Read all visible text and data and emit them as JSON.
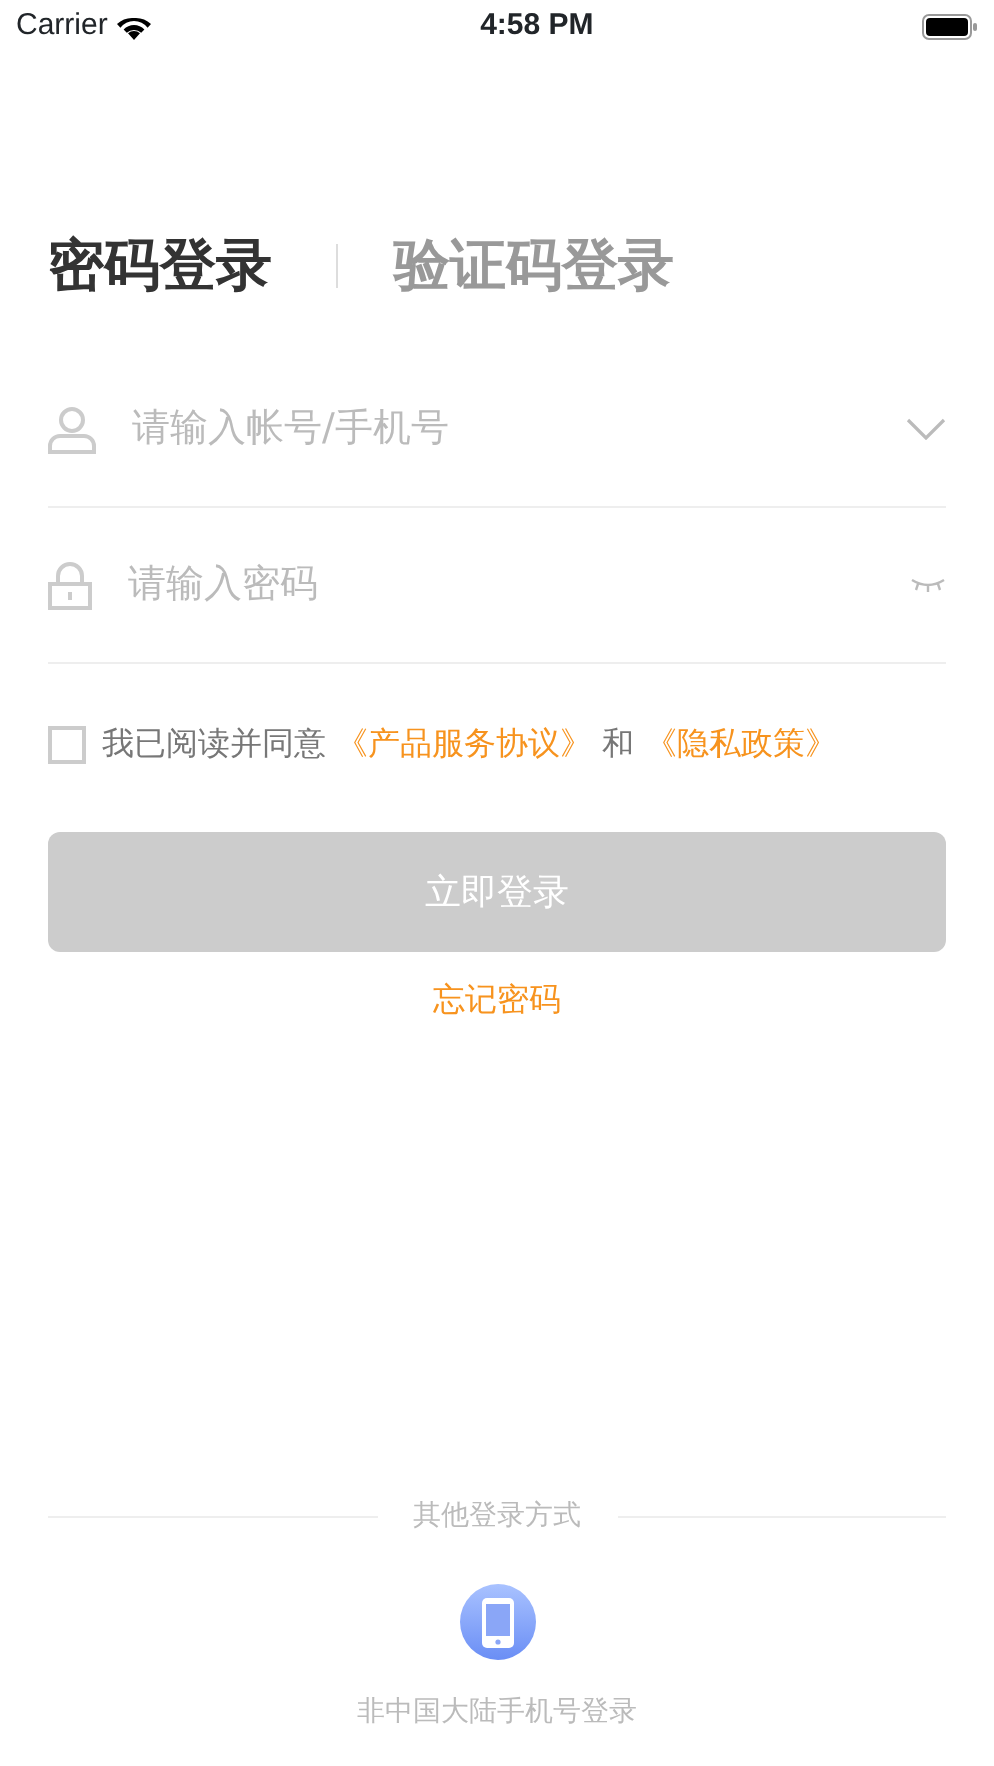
{
  "status_bar": {
    "carrier": "Carrier",
    "time": "4:58 PM"
  },
  "tabs": [
    {
      "label": "密码登录",
      "selected": true
    },
    {
      "label": "验证码登录",
      "selected": false
    }
  ],
  "fields": [
    {
      "kind": "account",
      "placeholder": "请输入帐号/手机号"
    },
    {
      "kind": "password",
      "placeholder": "请输入密码"
    }
  ],
  "agreement": {
    "checked": false,
    "text": "我已阅读并同意",
    "links": [
      "《产品服务协议》",
      "《隐私政策》"
    ],
    "joiner": "和"
  },
  "login_button": {
    "label": "立即登录",
    "disabled": true
  },
  "forgot_link": "忘记密码",
  "other_login": {
    "title": "其他登录方式",
    "label": "非中国大陆手机号登录"
  }
}
